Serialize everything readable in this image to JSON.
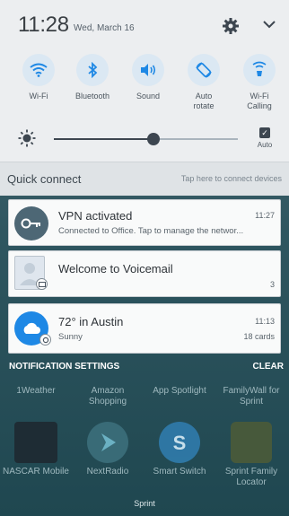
{
  "status": {
    "time": "11:28",
    "date": "Wed, March 16"
  },
  "icons": {
    "settings": "gear-icon",
    "expand": "chevron-down-icon"
  },
  "quick_toggles": [
    {
      "label": "Wi-Fi",
      "icon": "wifi-icon"
    },
    {
      "label": "Bluetooth",
      "icon": "bluetooth-icon"
    },
    {
      "label": "Sound",
      "icon": "sound-icon"
    },
    {
      "label": "Auto\nrotate",
      "icon": "auto-rotate-icon"
    },
    {
      "label": "Wi-Fi\nCalling",
      "icon": "wifi-calling-icon"
    }
  ],
  "brightness": {
    "level": 0.54,
    "auto_label": "Auto",
    "auto_checked": true
  },
  "quick_connect": {
    "title": "Quick connect",
    "hint": "Tap here to connect devices"
  },
  "notifications": [
    {
      "title": "VPN activated",
      "subtitle": "Connected to Office. Tap to manage the networ...",
      "time": "11:27",
      "icon": "vpn-key-icon"
    },
    {
      "title": "Welcome to Voicemail",
      "meta": "3",
      "icon": "voicemail-avatar-icon"
    },
    {
      "title": "72° in Austin",
      "subtitle": "Sunny",
      "time": "11:13",
      "meta": "18 cards",
      "icon": "weather-icon"
    }
  ],
  "notification_bar": {
    "settings": "NOTIFICATION SETTINGS",
    "clear": "CLEAR"
  },
  "home_apps": {
    "row1": [
      "1Weather",
      "Amazon Shopping",
      "App Spotlight",
      "FamilyWall for Sprint"
    ],
    "row2": [
      "NASCAR Mobile",
      "NextRadio",
      "Smart Switch",
      "Sprint Family Locator"
    ]
  },
  "carrier": "Sprint",
  "colors": {
    "accent": "#1e88e5",
    "toggle_bg": "#dbe8f3",
    "shade_bg": "#eceef0"
  }
}
